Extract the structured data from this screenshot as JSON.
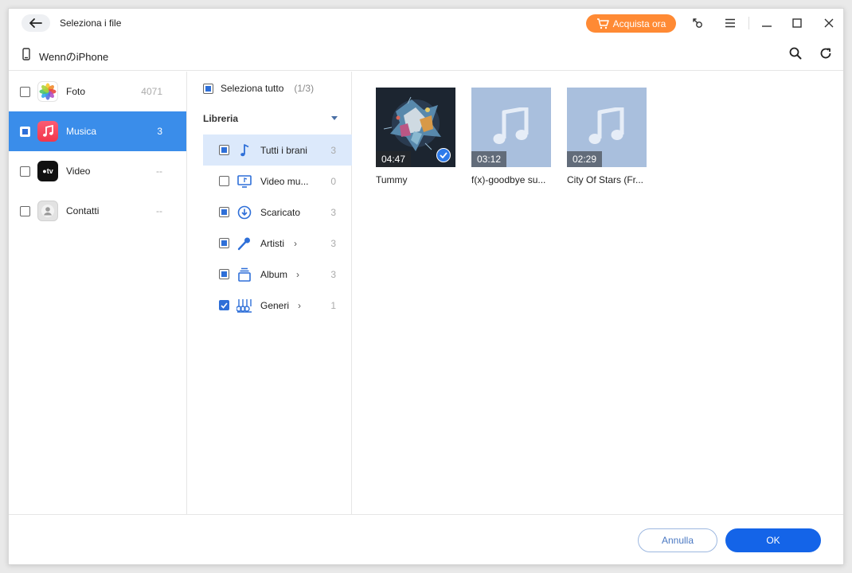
{
  "titlebar": {
    "title": "Seleziona i file",
    "buy_label": "Acquista ora",
    "accent": "#ff8a34"
  },
  "device": {
    "name": "WennのiPhone"
  },
  "categories": [
    {
      "label": "Foto",
      "count": "4071",
      "icon": "photos-icon",
      "state": "unchecked"
    },
    {
      "label": "Musica",
      "count": "3",
      "icon": "music-icon",
      "state": "partial"
    },
    {
      "label": "Video",
      "count": "--",
      "icon": "apple-tv-icon",
      "state": "unchecked"
    },
    {
      "label": "Contatti",
      "count": "--",
      "icon": "contacts-icon",
      "state": "unchecked"
    }
  ],
  "middle": {
    "select_all": "Seleziona tutto",
    "select_all_count": "(1/3)",
    "library_label": "Libreria",
    "items": [
      {
        "label": "Tutti i brani",
        "count": "3",
        "icon": "music-note-icon",
        "state": "partial",
        "arrow": false
      },
      {
        "label": "Video mu...",
        "count": "0",
        "icon": "music-video-icon",
        "state": "unchecked",
        "arrow": false
      },
      {
        "label": "Scaricato",
        "count": "3",
        "icon": "download-icon",
        "state": "partial",
        "arrow": false
      },
      {
        "label": "Artisti",
        "count": "3",
        "icon": "microphone-icon",
        "state": "partial",
        "arrow": true
      },
      {
        "label": "Album",
        "count": "3",
        "icon": "album-icon",
        "state": "partial",
        "arrow": true
      },
      {
        "label": "Generi",
        "count": "1",
        "icon": "genres-icon",
        "state": "checked",
        "arrow": true
      }
    ]
  },
  "tracks": [
    {
      "name": "Tummy",
      "duration": "04:47",
      "selected": true,
      "art": "album-art"
    },
    {
      "name": "f(x)-goodbye su...",
      "duration": "03:12",
      "selected": false,
      "art": "music-placeholder"
    },
    {
      "name": "City Of Stars (Fr...",
      "duration": "02:29",
      "selected": false,
      "art": "music-placeholder"
    }
  ],
  "footer": {
    "cancel": "Annulla",
    "ok": "OK"
  }
}
